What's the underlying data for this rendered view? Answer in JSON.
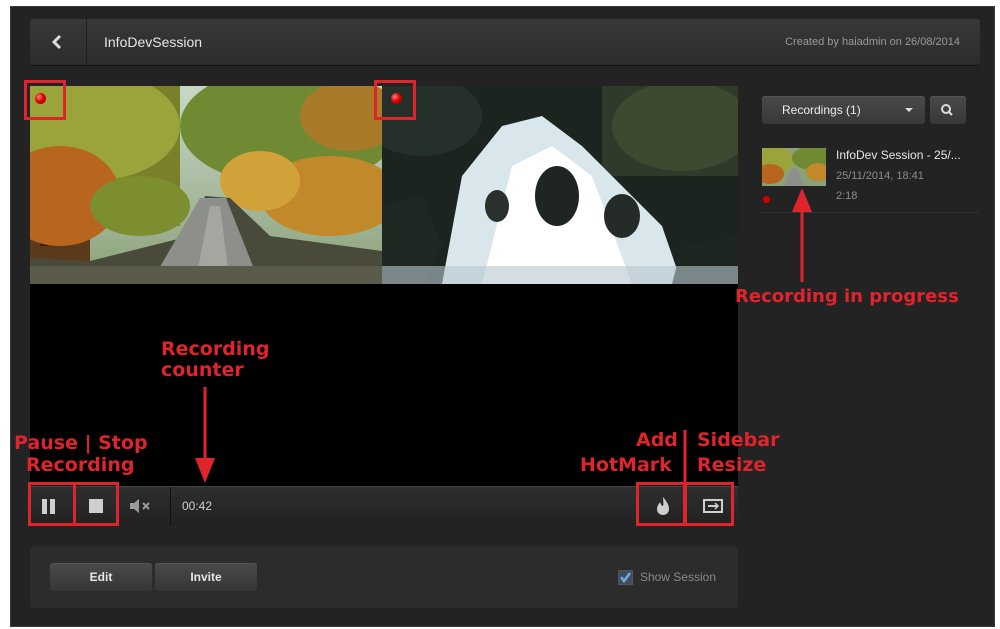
{
  "header": {
    "session_title": "InfoDevSession",
    "created_by": "Created by haiadmin on 26/08/2014"
  },
  "player": {
    "counter": "00:42"
  },
  "actions": {
    "edit_label": "Edit",
    "invite_label": "Invite",
    "show_session_label": "Show Session",
    "show_session_checked": true
  },
  "sidebar": {
    "recordings_label": "Recordings (1)",
    "recordings": [
      {
        "title": "InfoDev Session - 25/...",
        "date": "25/11/2014, 18:41",
        "duration": "2:18",
        "recording_in_progress": true
      }
    ]
  },
  "annotations": {
    "pause_stop_line1": "Pause | Stop",
    "pause_stop_line2": "Recording",
    "counter_line1": "Recording",
    "counter_line2": "counter",
    "hotmark_line1": "Add",
    "hotmark_line2": "HotMark",
    "sidebar_line1": "Sidebar",
    "sidebar_line2": "Resize",
    "recording_in_progress": "Recording in progress"
  },
  "colors": {
    "annotation": "#e0242c",
    "background": "#232323",
    "recording_dot": "#e00000"
  }
}
